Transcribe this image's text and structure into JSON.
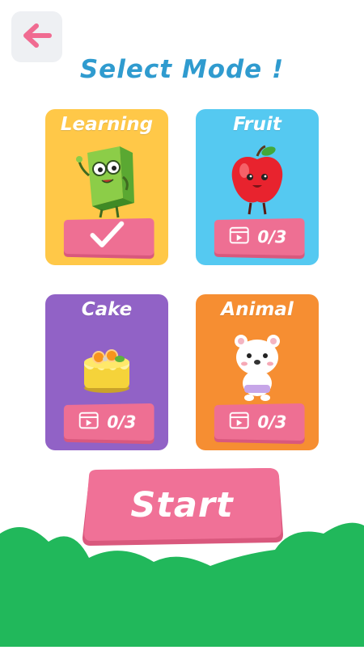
{
  "header": {
    "back_icon": "arrow-left-icon",
    "title": "Select Mode !"
  },
  "modes": [
    {
      "label": "Learning",
      "color": "#ffc848",
      "icon": "book-character-icon",
      "selected": true,
      "check_icon": "checkmark-icon"
    },
    {
      "label": "Fruit",
      "color": "#55c9f1",
      "icon": "apple-character-icon",
      "progress": "0/3",
      "progress_icon": "video-icon"
    },
    {
      "label": "Cake",
      "color": "#9162c6",
      "icon": "cake-icon",
      "progress": "0/3",
      "progress_icon": "video-icon"
    },
    {
      "label": "Animal",
      "color": "#f68e32",
      "icon": "bear-character-icon",
      "progress": "0/3",
      "progress_icon": "video-icon"
    }
  ],
  "start_button": {
    "label": "Start",
    "color": "#f07197"
  },
  "colors": {
    "title": "#2f9bcf",
    "button": "#ee6f93",
    "grass": "#21b85b",
    "back_arrow": "#f06b91"
  }
}
